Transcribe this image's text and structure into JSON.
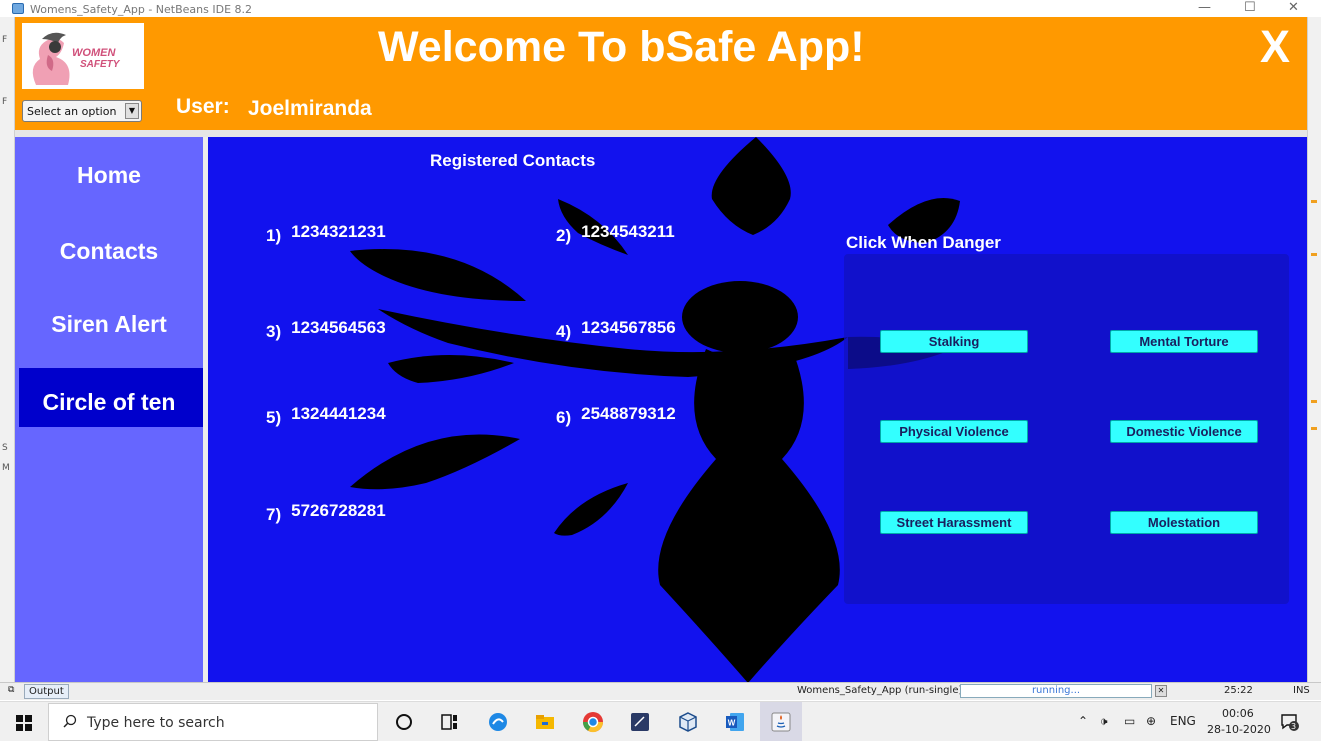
{
  "ide": {
    "title": "Womens_Safety_App - NetBeans IDE 8.2",
    "output_tab": "Output",
    "run_label": "Womens_Safety_App (run-single)",
    "progress_text": "running...",
    "caret_position": "25:22",
    "insert_mode": "INS"
  },
  "header": {
    "logo_text_top": "WOMEN",
    "logo_text_bottom": "SAFETY",
    "title": "Welcome To bSafe App!",
    "close_label": "X",
    "select_value": "Select an option",
    "user_label": "User:",
    "user_name": "Joelmiranda",
    "color": "#ff9900"
  },
  "sidebar": {
    "items": [
      {
        "label": "Home",
        "active": false
      },
      {
        "label": "Contacts",
        "active": false
      },
      {
        "label": "Siren Alert",
        "active": false
      },
      {
        "label": "Circle of ten",
        "active": true
      }
    ],
    "color": "#6666ff",
    "active_color": "#0000cc"
  },
  "main": {
    "registered_title": "Registered Contacts",
    "contacts": [
      {
        "index": "1)",
        "number": "1234321231"
      },
      {
        "index": "2)",
        "number": "1234543211"
      },
      {
        "index": "3)",
        "number": "1234564563"
      },
      {
        "index": "4)",
        "number": "1234567856"
      },
      {
        "index": "5)",
        "number": "1324441234"
      },
      {
        "index": "6)",
        "number": "2548879312"
      },
      {
        "index": "7)",
        "number": "5726728281"
      }
    ],
    "danger_title": "Click When Danger",
    "danger_buttons": [
      "Stalking",
      "Mental Torture",
      "Physical Violence",
      "Domestic Violence",
      "Street Harassment",
      "Molestation"
    ],
    "background_color": "#1212ee",
    "button_color": "#33ffff"
  },
  "taskbar": {
    "search_placeholder": "Type here to search",
    "language": "ENG",
    "time": "00:06",
    "date": "28-10-2020",
    "notification_count": "3"
  }
}
